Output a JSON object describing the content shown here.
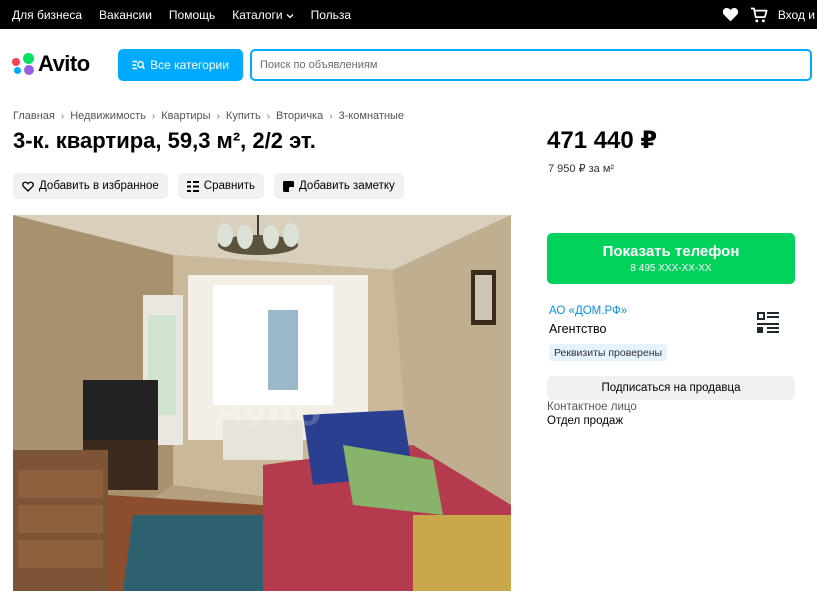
{
  "topbar": {
    "links": [
      "Для бизнеса",
      "Вакансии",
      "Помощь",
      "Каталоги",
      "Польза"
    ],
    "catalog_chevron_icon": "chevron-down-icon",
    "favorites_icon": "heart-icon",
    "cart_icon": "cart-icon",
    "login_label": "Вход и"
  },
  "header": {
    "logo_text": "Avito",
    "logo_colors": [
      "#04e061",
      "#ff4053",
      "#965eeb",
      "#0af"
    ],
    "categories_button": "Все категории",
    "search_placeholder": "Поиск по объявлениям"
  },
  "breadcrumbs": [
    "Главная",
    "Недвижимость",
    "Квартиры",
    "Купить",
    "Вторичка",
    "3-комнатные"
  ],
  "listing": {
    "title": "3-к. квартира, 59,3 м², 2/2 эт.",
    "actions": [
      {
        "label": "Добавить в избранное",
        "icon": "heart-outline-icon"
      },
      {
        "label": "Сравнить",
        "icon": "compare-icon"
      },
      {
        "label": "Добавить заметку",
        "icon": "note-icon"
      }
    ],
    "photo_alt": "Фото квартиры"
  },
  "sidebar": {
    "price": "471 440 ₽",
    "price_per_m": "7 950 ₽ за м²",
    "phone_button": "Показать телефон",
    "phone_masked": "8 495 XXX-XX-XX",
    "seller_name": "АО «ДОМ.РФ»",
    "seller_type": "Агентство",
    "verified_badge": "Реквизиты проверены",
    "subscribe_button": "Подписаться на продавца",
    "contact_label": "Контактное лицо",
    "contact_value": "Отдел продаж"
  },
  "colors": {
    "accent_blue": "#00aaff",
    "green": "#02d15c",
    "link_blue": "#0a8ff0",
    "button_gray": "#f2f1f0"
  }
}
